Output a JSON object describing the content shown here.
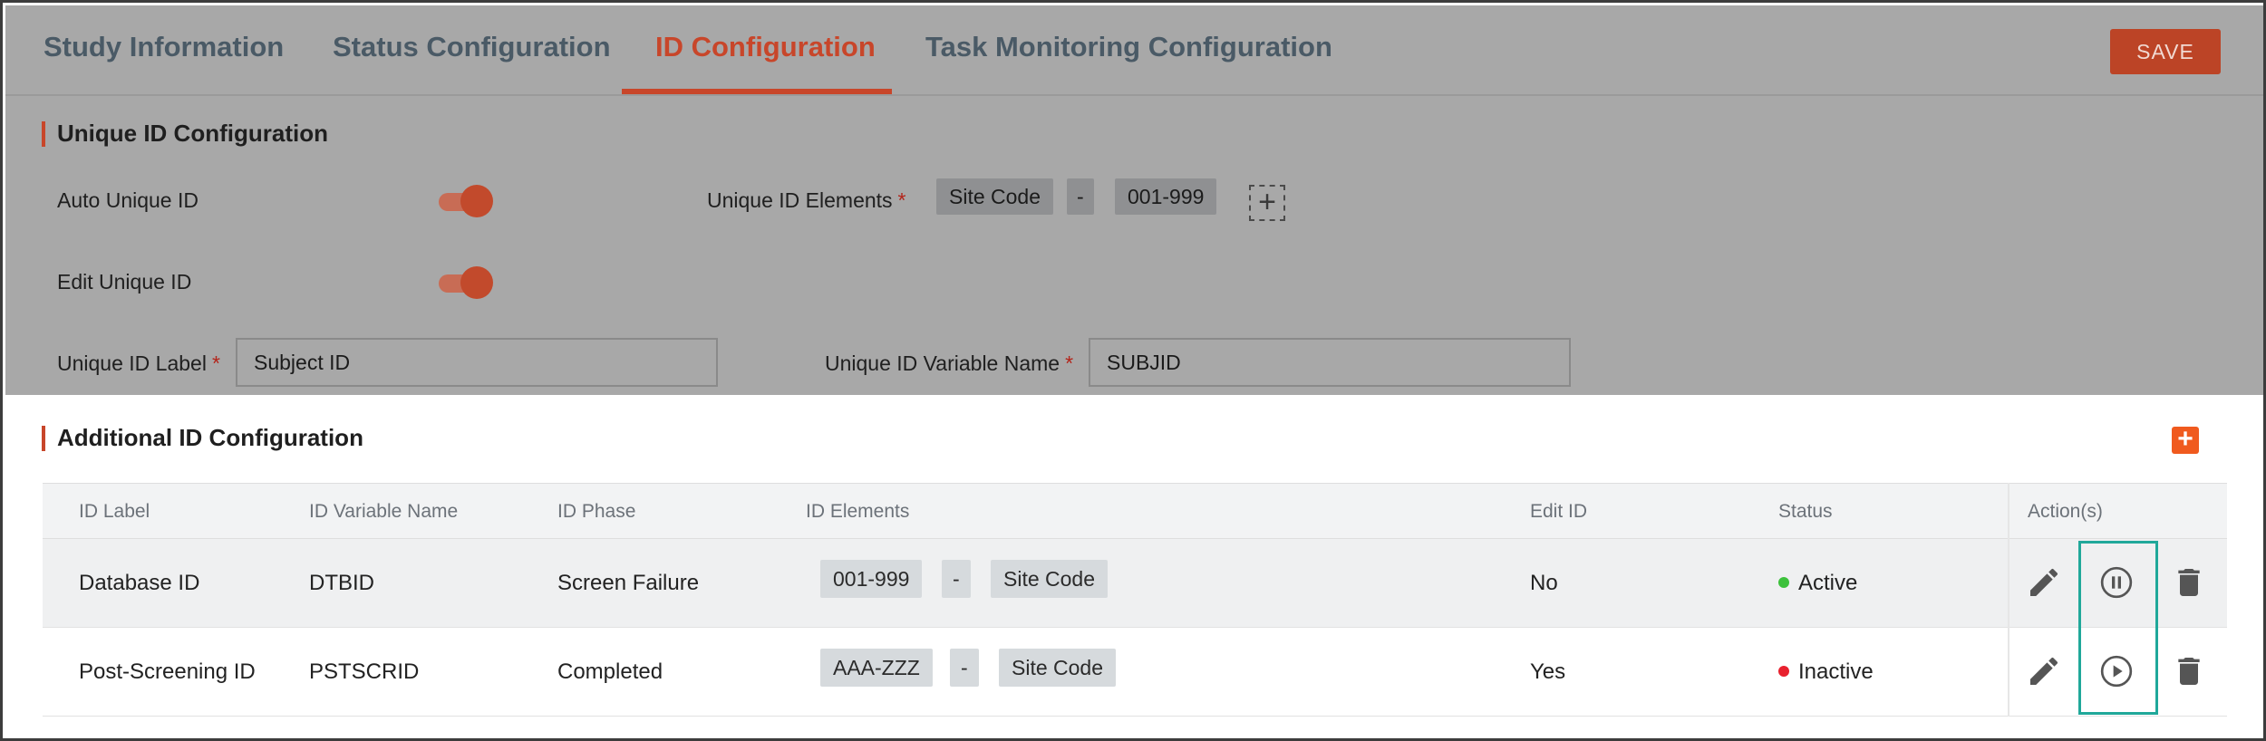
{
  "tabs": [
    {
      "label": "Study Information",
      "active": false
    },
    {
      "label": "Status Configuration",
      "active": false
    },
    {
      "label": "ID Configuration",
      "active": true
    },
    {
      "label": "Task Monitoring Configuration",
      "active": false
    }
  ],
  "save_label": "SAVE",
  "unique": {
    "title": "Unique ID Configuration",
    "auto_label": "Auto Unique ID",
    "auto_on": true,
    "edit_label": "Edit Unique ID",
    "edit_on": true,
    "elements_label": "Unique ID Elements",
    "elements": [
      "Site Code",
      "-",
      "001-999"
    ],
    "add_icon": "plus-dashed-icon",
    "id_label_label": "Unique ID Label",
    "id_label_value": "Subject ID",
    "var_name_label": "Unique ID Variable Name",
    "var_name_value": "SUBJID",
    "required_mark": "*"
  },
  "additional": {
    "title": "Additional ID Configuration",
    "add_icon": "plus-icon",
    "columns": [
      "ID Label",
      "ID Variable Name",
      "ID Phase",
      "ID Elements",
      "Edit ID",
      "Status",
      "Action(s)"
    ],
    "rows": [
      {
        "label": "Database ID",
        "var": "DTBID",
        "phase": "Screen Failure",
        "elements": [
          "001-999",
          "-",
          "Site Code"
        ],
        "edit": "No",
        "status": "Active",
        "status_color": "#3cc13b",
        "toggle_icon": "pause-circle-icon"
      },
      {
        "label": "Post-Screening ID",
        "var": "PSTSCRID",
        "phase": "Completed",
        "elements": [
          "AAA-ZZZ",
          "-",
          "Site Code"
        ],
        "edit": "Yes",
        "status": "Inactive",
        "status_color": "#e8212e",
        "toggle_icon": "play-circle-icon"
      }
    ]
  },
  "colors": {
    "accent": "#c8462a",
    "highlight": "#20a89a",
    "add_button": "#f05a1e"
  }
}
